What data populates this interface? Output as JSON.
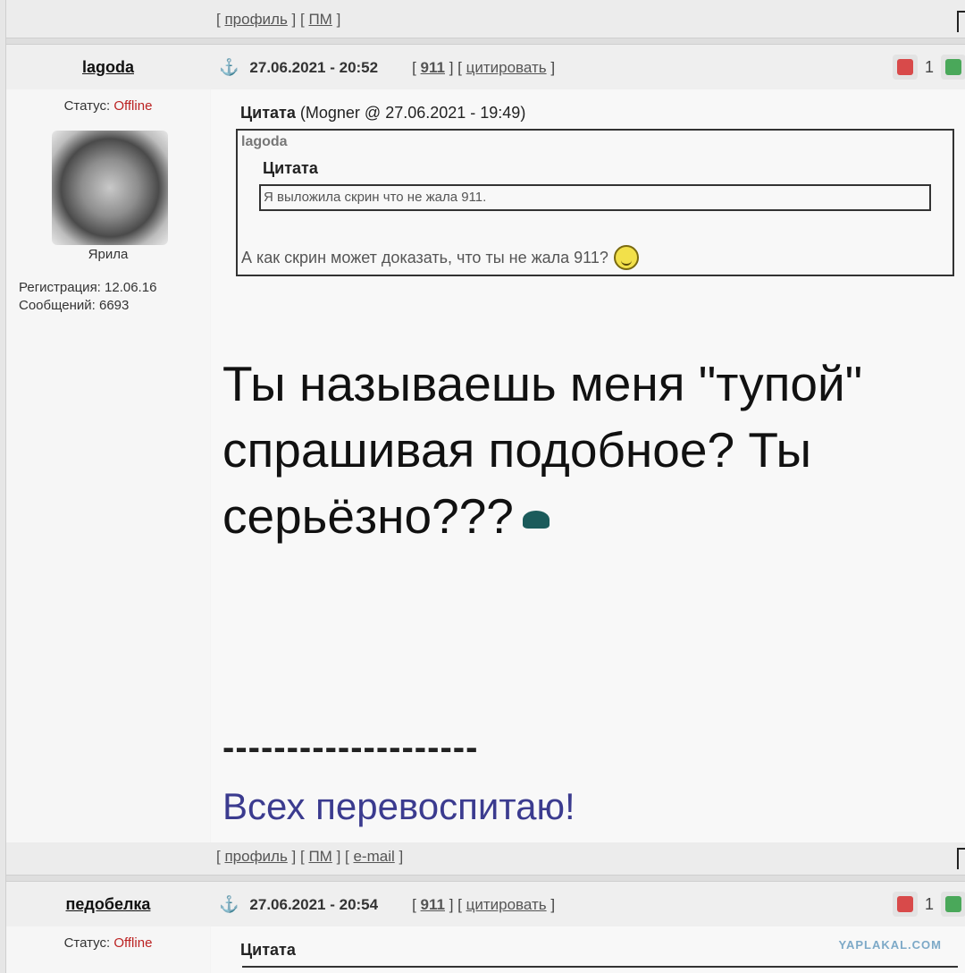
{
  "top_bar": {
    "profile": "профиль",
    "pm": "ПМ"
  },
  "post1": {
    "username": "lagoda",
    "datetime": "27.06.2021 - 20:52",
    "post_number": "911",
    "quote_action": "цитировать",
    "rating": "1",
    "status_label": "Статус:",
    "status_value": "Offline",
    "rank": "Ярила",
    "registration": "Регистрация: 12.06.16",
    "messages": "Сообщений: 6693",
    "quote_label": "Цитата",
    "quote_source": "(Mogner @ 27.06.2021 - 19:49)",
    "quote_author": "lagoda",
    "inner_quote_label": "Цитата",
    "inner_quote_text": "Я выложила скрин что не жала 911.",
    "quote_reply": "А как скрин может доказать, что ты не жала 911?",
    "message": "Ты называешь меня \"тупой\" спрашивая подобное? Ты серьёзно???",
    "sig_divider": "--------------------",
    "signature": "Всех перевоспитаю!"
  },
  "bottom_bar": {
    "profile": "профиль",
    "pm": "ПМ",
    "email": "e-mail"
  },
  "post2": {
    "username": "педобелка",
    "datetime": "27.06.2021 - 20:54",
    "post_number": "911",
    "quote_action": "цитировать",
    "rating": "1",
    "status_label": "Статус:",
    "status_value": "Offline",
    "quote_label": "Цитата"
  },
  "watermark": "YAPLAKAL.COM",
  "icons": [
    "anchor-icon",
    "thumbs-down-icon",
    "thumbs-up-icon",
    "smile-icon",
    "turtle-icon"
  ]
}
